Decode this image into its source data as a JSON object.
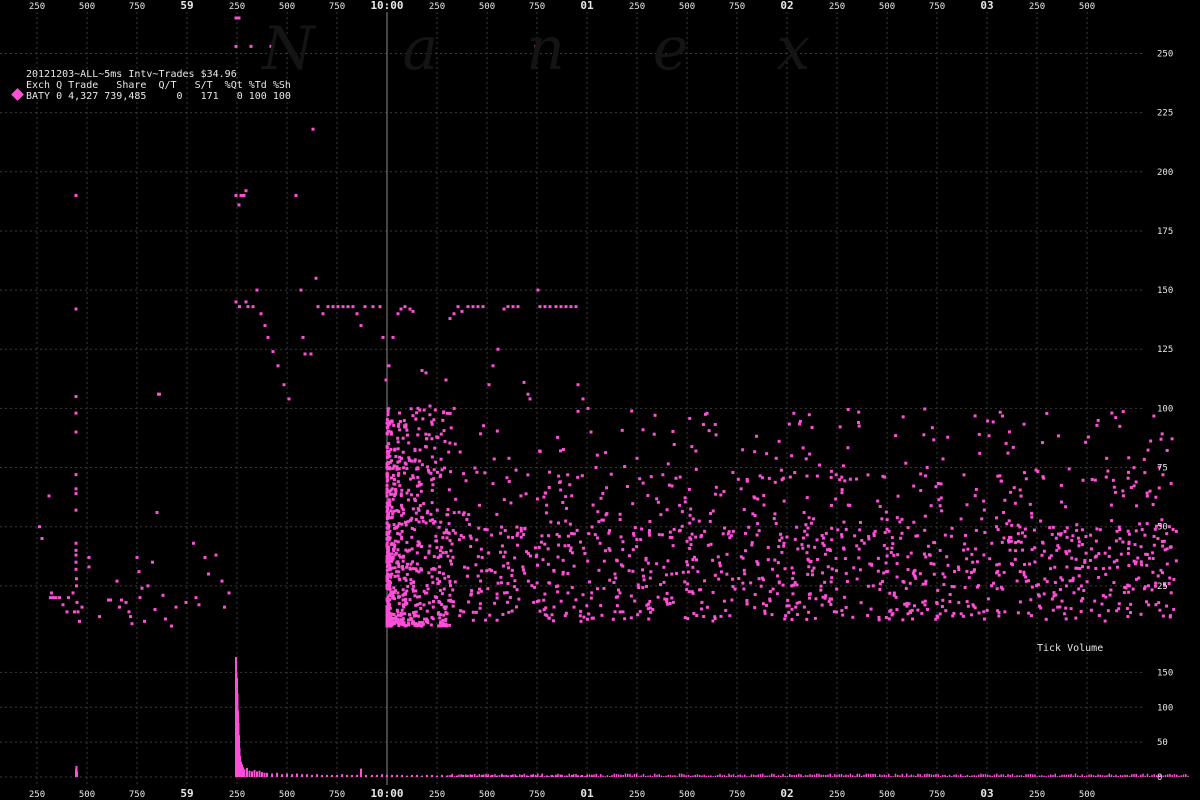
{
  "header": {
    "title": "20121203~ALL~5ms Intv~Trades $34.96",
    "columns": "Exch Q Trade   Share  Q/T   S/T  %Qt %Td %Sh",
    "row": "BATY 0 4,327 739,485     0   171   0 100 100"
  },
  "watermark": "Nanex",
  "tick_volume_label": "Tick Volume",
  "colors": {
    "background": "#000000",
    "series": "#ff4fd8",
    "grid": "#3a3a3a",
    "divider": "#8a8a8a",
    "text": "#e8e8e8"
  },
  "chart_data": [
    {
      "type": "scatter",
      "title": "",
      "x_tick_labels": [
        "250",
        "500",
        "750",
        "59",
        "250",
        "500",
        "750",
        "10:00",
        "250",
        "500",
        "750",
        "01",
        "250",
        "500",
        "750",
        "02",
        "250",
        "500",
        "750",
        "03",
        "250",
        "500"
      ],
      "y_tick_labels": [
        "25",
        "50",
        "75",
        "100",
        "125",
        "150",
        "175",
        "200",
        "225",
        "250"
      ],
      "ylim": [
        0,
        265
      ],
      "grid": true,
      "series": [
        {
          "name": "BATY",
          "color": "#ff4fd8"
        }
      ],
      "points": [
        [
          0.05,
          50
        ],
        [
          0.1,
          45
        ],
        [
          0.24,
          63
        ],
        [
          0.29,
          22
        ],
        [
          0.27,
          20
        ],
        [
          0.33,
          20
        ],
        [
          0.38,
          20
        ],
        [
          0.45,
          20
        ],
        [
          0.52,
          17
        ],
        [
          0.6,
          14
        ],
        [
          0.63,
          20
        ],
        [
          0.72,
          22
        ],
        [
          0.75,
          14
        ],
        [
          0.78,
          190
        ],
        [
          0.78,
          142
        ],
        [
          0.78,
          105
        ],
        [
          0.78,
          98
        ],
        [
          0.78,
          90
        ],
        [
          0.78,
          72
        ],
        [
          0.78,
          66
        ],
        [
          0.78,
          64
        ],
        [
          0.78,
          57
        ],
        [
          0.78,
          43
        ],
        [
          0.78,
          40
        ],
        [
          0.78,
          38
        ],
        [
          0.78,
          35
        ],
        [
          0.78,
          32
        ],
        [
          0.79,
          28
        ],
        [
          0.79,
          25
        ],
        [
          0.8,
          18
        ],
        [
          0.82,
          14
        ],
        [
          0.85,
          10
        ],
        [
          0.9,
          16
        ],
        [
          1.04,
          37
        ],
        [
          1.04,
          33
        ],
        [
          1.25,
          12
        ],
        [
          1.43,
          19
        ],
        [
          1.47,
          19
        ],
        [
          1.6,
          27
        ],
        [
          1.65,
          16
        ],
        [
          1.69,
          19
        ],
        [
          1.78,
          18
        ],
        [
          1.84,
          14
        ],
        [
          1.87,
          12
        ],
        [
          1.9,
          9
        ],
        [
          2.0,
          37
        ],
        [
          2.04,
          31
        ],
        [
          2.06,
          20
        ],
        [
          2.1,
          24
        ],
        [
          2.15,
          10
        ],
        [
          2.22,
          25
        ],
        [
          2.31,
          35
        ],
        [
          2.36,
          15
        ],
        [
          2.4,
          56
        ],
        [
          2.43,
          106
        ],
        [
          2.45,
          106
        ],
        [
          2.52,
          21
        ],
        [
          2.57,
          11
        ],
        [
          2.69,
          8
        ],
        [
          2.78,
          16
        ],
        [
          2.98,
          18
        ],
        [
          3.13,
          43
        ],
        [
          3.18,
          20
        ],
        [
          3.24,
          17
        ],
        [
          3.36,
          37
        ],
        [
          3.43,
          30
        ],
        [
          3.58,
          38
        ],
        [
          3.7,
          27
        ],
        [
          3.75,
          16
        ],
        [
          3.84,
          22
        ],
        [
          3.98,
          265
        ],
        [
          3.98,
          253
        ],
        [
          4.04,
          265
        ],
        [
          3.98,
          190
        ],
        [
          4.04,
          186
        ],
        [
          4.14,
          190
        ],
        [
          4.08,
          190
        ],
        [
          4.18,
          192
        ],
        [
          4.28,
          253
        ],
        [
          3.98,
          145
        ],
        [
          4.05,
          143
        ],
        [
          4.18,
          145
        ],
        [
          4.22,
          143
        ],
        [
          4.32,
          143
        ],
        [
          4.4,
          150
        ],
        [
          4.48,
          140
        ],
        [
          4.56,
          135
        ],
        [
          4.62,
          130
        ],
        [
          4.72,
          124
        ],
        [
          4.82,
          118
        ],
        [
          4.94,
          110
        ],
        [
          5.04,
          104
        ],
        [
          4.68,
          253
        ],
        [
          5.18,
          190
        ],
        [
          5.28,
          150
        ],
        [
          5.32,
          130
        ],
        [
          5.36,
          123
        ],
        [
          5.48,
          123
        ],
        [
          5.52,
          218
        ],
        [
          5.58,
          155
        ],
        [
          5.62,
          143
        ],
        [
          5.72,
          140
        ],
        [
          5.82,
          143
        ],
        [
          5.92,
          143
        ],
        [
          6.02,
          143
        ],
        [
          6.12,
          143
        ],
        [
          6.22,
          143
        ],
        [
          6.32,
          143
        ],
        [
          6.4,
          140
        ],
        [
          6.48,
          135
        ],
        [
          6.56,
          143
        ],
        [
          6.72,
          143
        ],
        [
          6.86,
          143
        ],
        [
          6.92,
          130
        ],
        [
          6.98,
          112
        ],
        [
          7.04,
          118
        ],
        [
          7.12,
          130
        ],
        [
          7.22,
          140
        ],
        [
          7.28,
          142
        ],
        [
          7.36,
          143
        ],
        [
          7.46,
          142
        ],
        [
          7.52,
          141
        ],
        [
          7.62,
          100
        ],
        [
          7.7,
          116
        ],
        [
          7.78,
          115
        ],
        [
          7.86,
          101
        ],
        [
          8.18,
          112
        ],
        [
          8.26,
          138
        ],
        [
          8.34,
          140
        ],
        [
          8.42,
          143
        ],
        [
          8.5,
          141
        ],
        [
          8.62,
          143
        ],
        [
          8.72,
          143
        ],
        [
          8.82,
          143
        ],
        [
          8.92,
          143
        ],
        [
          9.04,
          110
        ],
        [
          9.12,
          118
        ],
        [
          9.22,
          125
        ],
        [
          9.34,
          142
        ],
        [
          9.42,
          143
        ],
        [
          9.52,
          143
        ],
        [
          9.62,
          143
        ],
        [
          9.74,
          111
        ],
        [
          9.82,
          106
        ],
        [
          9.86,
          104
        ],
        [
          9.98,
          253
        ],
        [
          10.02,
          150
        ],
        [
          10.06,
          143
        ],
        [
          10.16,
          143
        ],
        [
          10.26,
          143
        ],
        [
          10.38,
          143
        ],
        [
          10.48,
          143
        ],
        [
          10.58,
          143
        ],
        [
          10.68,
          143
        ],
        [
          10.78,
          143
        ],
        [
          10.82,
          110
        ],
        [
          10.92,
          104
        ],
        [
          11.02,
          100
        ],
        [
          11.08,
          90
        ],
        [
          11.18,
          75
        ],
        [
          11.28,
          62
        ],
        [
          11.38,
          55
        ],
        [
          11.46,
          40
        ],
        [
          11.56,
          30
        ],
        [
          11.66,
          22
        ],
        [
          11.72,
          14
        ],
        [
          10.88,
          10
        ],
        [
          10.74,
          16
        ],
        [
          10.62,
          22
        ],
        [
          10.52,
          30
        ]
      ]
    },
    {
      "type": "bar",
      "title": "",
      "ylabel": "Tick Volume",
      "y_tick_labels": [
        "0",
        "50",
        "100",
        "150"
      ],
      "ylim": [
        0,
        185
      ],
      "series": [
        {
          "name": "BATY",
          "color": "#ff4fd8"
        }
      ],
      "bars": [
        [
          0.78,
          12
        ],
        [
          0.79,
          16
        ],
        [
          0.8,
          8
        ],
        [
          3.98,
          172
        ],
        [
          3.99,
          150
        ],
        [
          4.0,
          142
        ],
        [
          4.01,
          120
        ],
        [
          4.02,
          95
        ],
        [
          4.03,
          78
        ],
        [
          4.04,
          60
        ],
        [
          4.05,
          42
        ],
        [
          4.06,
          30
        ],
        [
          4.08,
          22
        ],
        [
          4.1,
          18
        ],
        [
          4.12,
          14
        ],
        [
          4.15,
          11
        ],
        [
          4.2,
          13
        ],
        [
          4.25,
          9
        ],
        [
          4.3,
          8
        ],
        [
          4.35,
          10
        ],
        [
          4.4,
          8
        ],
        [
          4.45,
          9
        ],
        [
          4.5,
          7
        ],
        [
          4.55,
          6
        ],
        [
          4.6,
          6
        ],
        [
          4.7,
          5
        ],
        [
          4.8,
          6
        ],
        [
          4.9,
          4
        ],
        [
          5.0,
          5
        ],
        [
          5.1,
          4
        ],
        [
          5.2,
          5
        ],
        [
          5.3,
          4
        ],
        [
          5.4,
          4
        ],
        [
          5.5,
          3
        ],
        [
          5.6,
          4
        ],
        [
          5.7,
          3
        ],
        [
          5.8,
          3
        ],
        [
          5.9,
          3
        ],
        [
          6.0,
          3
        ],
        [
          6.1,
          4
        ],
        [
          6.2,
          3
        ],
        [
          6.3,
          3
        ],
        [
          6.4,
          3
        ],
        [
          6.48,
          12
        ],
        [
          6.58,
          3
        ],
        [
          6.7,
          3
        ],
        [
          6.8,
          3
        ],
        [
          6.9,
          4
        ],
        [
          7.0,
          3
        ],
        [
          7.1,
          3
        ],
        [
          7.2,
          3
        ],
        [
          7.3,
          3
        ],
        [
          7.4,
          2
        ],
        [
          7.5,
          3
        ],
        [
          7.6,
          3
        ],
        [
          7.7,
          2
        ],
        [
          7.8,
          3
        ],
        [
          7.9,
          3
        ],
        [
          8.0,
          2
        ],
        [
          8.1,
          3
        ],
        [
          8.2,
          2
        ],
        [
          8.3,
          3
        ],
        [
          8.4,
          2
        ],
        [
          8.5,
          3
        ],
        [
          8.6,
          2
        ],
        [
          8.7,
          3
        ],
        [
          8.8,
          2
        ],
        [
          8.9,
          3
        ],
        [
          9.0,
          2
        ],
        [
          9.1,
          3
        ],
        [
          9.2,
          2
        ],
        [
          9.3,
          3
        ],
        [
          9.4,
          2
        ],
        [
          9.5,
          3
        ],
        [
          9.6,
          2
        ],
        [
          9.7,
          3
        ],
        [
          9.8,
          2
        ],
        [
          9.9,
          3
        ],
        [
          10.0,
          2
        ],
        [
          10.1,
          3
        ],
        [
          10.2,
          2
        ],
        [
          10.3,
          3
        ],
        [
          10.4,
          2
        ],
        [
          10.5,
          3
        ],
        [
          10.6,
          2
        ],
        [
          10.7,
          3
        ],
        [
          10.8,
          2
        ],
        [
          10.9,
          3
        ],
        [
          11.0,
          2
        ],
        [
          11.1,
          2
        ]
      ]
    }
  ]
}
